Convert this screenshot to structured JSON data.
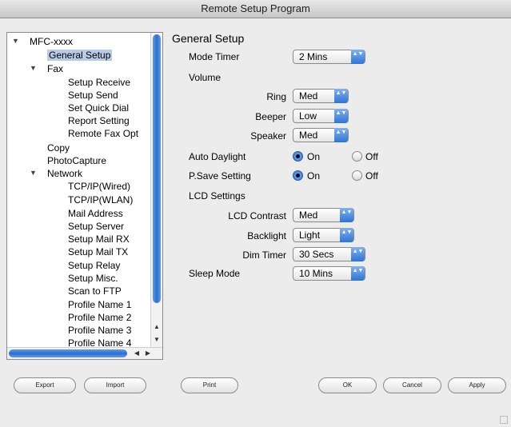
{
  "window": {
    "title": "Remote Setup Program"
  },
  "tree": {
    "items": [
      {
        "label": "MFC-xxxx",
        "expanded": true
      },
      {
        "label": "General Setup",
        "selected": true
      },
      {
        "label": "Fax",
        "expanded": true
      },
      {
        "label": "Setup Receive"
      },
      {
        "label": "Setup Send"
      },
      {
        "label": "Set Quick Dial"
      },
      {
        "label": "Report Setting"
      },
      {
        "label": "Remote Fax Opt"
      },
      {
        "label": "Copy"
      },
      {
        "label": "PhotoCapture"
      },
      {
        "label": "Network",
        "expanded": true
      },
      {
        "label": "TCP/IP(Wired)"
      },
      {
        "label": "TCP/IP(WLAN)"
      },
      {
        "label": "Mail Address"
      },
      {
        "label": "Setup Server"
      },
      {
        "label": "Setup Mail RX"
      },
      {
        "label": "Setup Mail TX"
      },
      {
        "label": "Setup Relay"
      },
      {
        "label": "Setup Misc."
      },
      {
        "label": "Scan to FTP"
      },
      {
        "label": "Profile Name 1"
      },
      {
        "label": "Profile Name 2"
      },
      {
        "label": "Profile Name 3"
      },
      {
        "label": "Profile Name 4"
      }
    ],
    "tri_open": "▼",
    "arrow_up": "▲",
    "arrow_down": "▼",
    "arrow_left": "◀",
    "arrow_right": "▶"
  },
  "panel": {
    "title": "General Setup",
    "mode_timer": {
      "label": "Mode Timer",
      "value": "2 Mins"
    },
    "volume": {
      "label": "Volume",
      "ring": {
        "label": "Ring",
        "value": "Med"
      },
      "beeper": {
        "label": "Beeper",
        "value": "Low"
      },
      "speaker": {
        "label": "Speaker",
        "value": "Med"
      }
    },
    "auto_daylight": {
      "label": "Auto Daylight",
      "on": "On",
      "off": "Off",
      "selected": "On"
    },
    "psave": {
      "label": "P.Save Setting",
      "on": "On",
      "off": "Off",
      "selected": "On"
    },
    "lcd": {
      "label": "LCD Settings",
      "contrast": {
        "label": "LCD Contrast",
        "value": "Med"
      },
      "backlight": {
        "label": "Backlight",
        "value": "Light"
      },
      "dim_timer": {
        "label": "Dim Timer",
        "value": "30 Secs"
      }
    },
    "sleep_mode": {
      "label": "Sleep Mode",
      "value": "10 Mins"
    },
    "stepper_glyph": "▲▼"
  },
  "buttons": {
    "export": "Export",
    "import": "Import",
    "print": "Print",
    "ok": "OK",
    "cancel": "Cancel",
    "apply": "Apply"
  }
}
